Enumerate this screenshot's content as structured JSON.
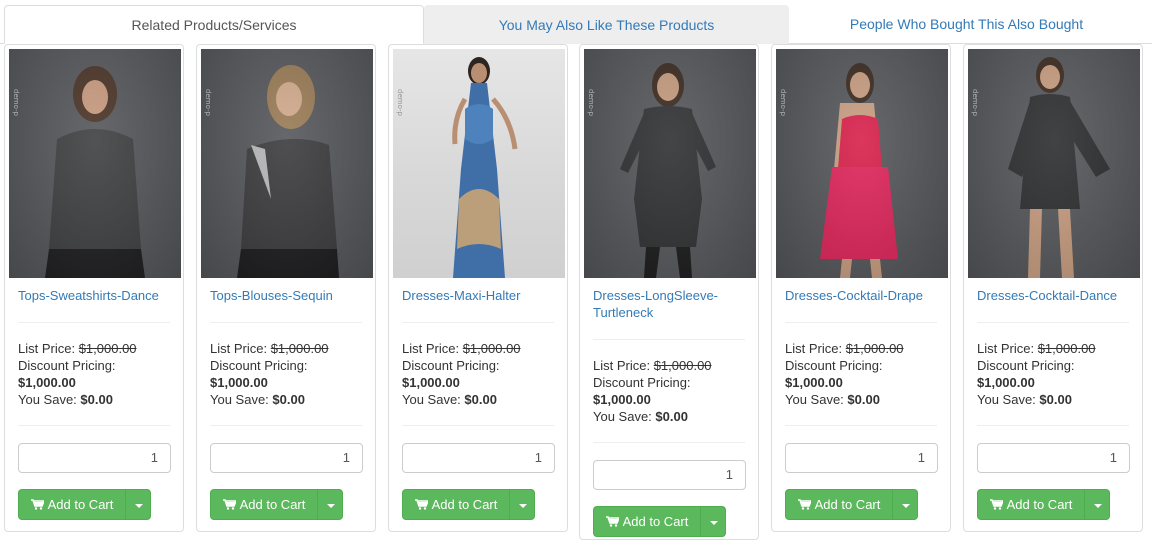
{
  "tabs": [
    {
      "label": "Related Products/Services"
    },
    {
      "label": "You May Also Like These Products"
    },
    {
      "label": "People Who Bought This Also Bought"
    }
  ],
  "watermark": "demo-p",
  "colors": {
    "link": "#337ab7",
    "button": "#5cb85c",
    "border": "#dddddd"
  },
  "pricing": {
    "list_label": "List Price:",
    "discount_label": "Discount Pricing:",
    "save_label": "You Save:",
    "button_label": "Add to Cart"
  },
  "products": [
    {
      "name": "Tops-Sweatshirts-Dance",
      "list_price": "$1,000.00",
      "discount_price": "$1,000.00",
      "you_save": "$0.00",
      "qty": "1"
    },
    {
      "name": "Tops-Blouses-Sequin",
      "list_price": "$1,000.00",
      "discount_price": "$1,000.00",
      "you_save": "$0.00",
      "qty": "1"
    },
    {
      "name": "Dresses-Maxi-Halter",
      "list_price": "$1,000.00",
      "discount_price": "$1,000.00",
      "you_save": "$0.00",
      "qty": "1"
    },
    {
      "name": "Dresses-LongSleeve-Turtleneck",
      "list_price": "$1,000.00",
      "discount_price": "$1,000.00",
      "you_save": "$0.00",
      "qty": "1"
    },
    {
      "name": "Dresses-Cocktail-Drape",
      "list_price": "$1,000.00",
      "discount_price": "$1,000.00",
      "you_save": "$0.00",
      "qty": "1"
    },
    {
      "name": "Dresses-Cocktail-Dance",
      "list_price": "$1,000.00",
      "discount_price": "$1,000.00",
      "you_save": "$0.00",
      "qty": "1"
    }
  ]
}
